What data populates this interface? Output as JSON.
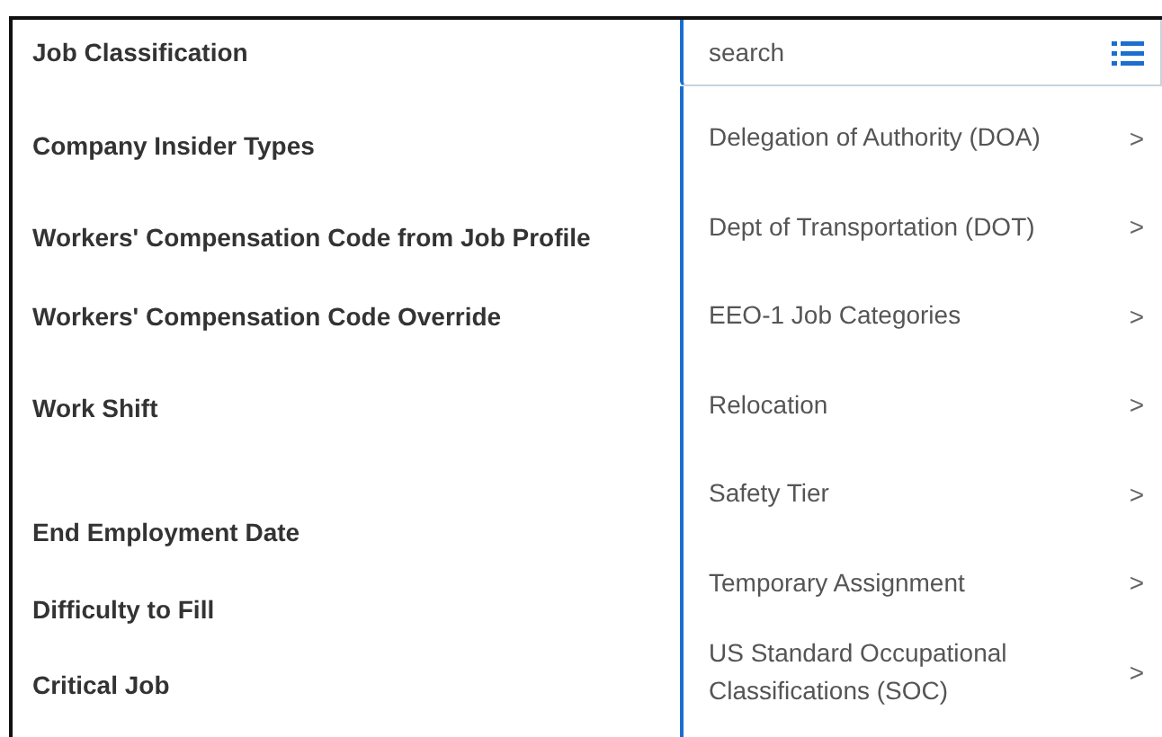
{
  "fields": [
    {
      "label": "Job Classification"
    },
    {
      "label": "Company Insider Types"
    },
    {
      "label": "Workers' Compensation Code from Job Profile"
    },
    {
      "label": "Workers' Compensation Code Override"
    },
    {
      "label": "Work Shift"
    },
    {
      "label": "End Employment Date"
    },
    {
      "label": "Difficulty to Fill"
    },
    {
      "label": "Critical Job"
    }
  ],
  "search": {
    "placeholder": "search"
  },
  "options": [
    {
      "label": "Delegation of Authority (DOA)",
      "chevron": ">"
    },
    {
      "label": "Dept of Transportation (DOT)",
      "chevron": ">"
    },
    {
      "label": "EEO-1 Job Categories",
      "chevron": ">"
    },
    {
      "label": "Relocation",
      "chevron": ">"
    },
    {
      "label": "Safety Tier",
      "chevron": ">"
    },
    {
      "label": "Temporary Assignment",
      "chevron": ">"
    },
    {
      "label": "US Standard Occupational Classifications (SOC)",
      "chevron": ">"
    }
  ]
}
